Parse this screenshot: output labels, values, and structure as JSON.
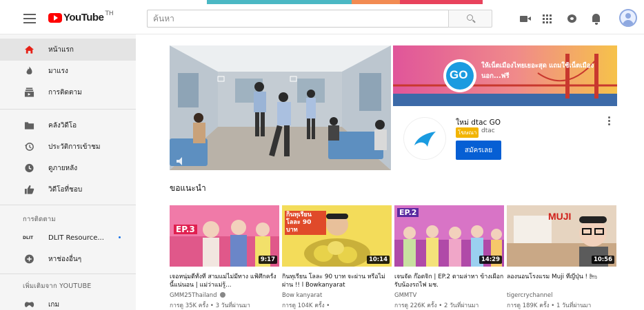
{
  "colors": {
    "brand_red": "#ff0000",
    "accent_blue": "#065fd4",
    "sidebar_bg": "#f5f5f5"
  },
  "header": {
    "logo_text": "YouTube",
    "region": "TH",
    "search_placeholder": "ค้นหา",
    "icons": [
      "menu-icon",
      "search-icon",
      "video-camera-icon",
      "apps-grid-icon",
      "messages-icon",
      "notifications-bell-icon",
      "avatar-icon"
    ]
  },
  "sidebar": {
    "main": [
      {
        "label": "หน้าแรก",
        "icon": "home-icon",
        "active": true
      },
      {
        "label": "มาแรง",
        "icon": "trending-flame-icon"
      },
      {
        "label": "การติดตาม",
        "icon": "subscriptions-icon"
      }
    ],
    "library": [
      {
        "label": "คลังวิดีโอ",
        "icon": "folder-icon"
      },
      {
        "label": "ประวัติการเข้าชม",
        "icon": "history-icon"
      },
      {
        "label": "ดูภายหลัง",
        "icon": "clock-icon"
      },
      {
        "label": "วิดีโอที่ชอบ",
        "icon": "thumbs-up-icon"
      }
    ],
    "subscriptions_heading": "การติดตาม",
    "subscriptions": [
      {
        "label": "DLIT Resource...",
        "badge": "DLIT",
        "new": true
      },
      {
        "label": "หาช่องอื่นๆ",
        "icon": "add-circle-icon"
      }
    ],
    "more_heading": "เพิ่มเติมจาก YOUTUBE",
    "more": [
      {
        "label": "เกม",
        "icon": "gaming-icon"
      }
    ]
  },
  "ad": {
    "banner_text": "ให้เน็ตเมืองไทยเยอะสุด แถมใช้เน็ตเมืองนอก...ฟรี",
    "banner_logo": "GO",
    "title": "ใหม่ dtac GO",
    "badge": "โฆษณา",
    "sponsor": "dtac",
    "cta": "สมัครเลย"
  },
  "section_title": "ขอแนะนำ",
  "videos": [
    {
      "title": "เจอหนุ่มตี๋ทั้งที่ สามแม่ไม่มีทาง แฟ้ศึกครั้งนี้แน่นอน | แม่ว่าแม่รู้...",
      "channel": "GMM25Thailand",
      "verified": true,
      "meta": "การดู 35K ครั้ง • 3 วันที่ผ่านมา",
      "duration": "9:17",
      "overlay": "EP.3"
    },
    {
      "title": "กินทุเรียน โลละ 90 บาท จะผ่าน หรือไม่ผ่าน !! l Bowkanyarat",
      "channel": "Bow kanyarat",
      "verified": false,
      "meta": "การดู 104K ครั้ง •",
      "duration": "10:14",
      "overlay": "กินทุเรียน โลละ 90 บาท"
    },
    {
      "title": "เจนจัด ก๊อตจิก | EP.2 ตามล่าหา ข้างเผือก รับน้องรถไฟ มช.",
      "channel": "GMMTV",
      "verified": false,
      "meta": "การดู 226K ครั้ง • 2 วันที่ผ่านมา",
      "duration": "14:29",
      "overlay": "EP.2"
    },
    {
      "title": "ลองนอนโรงแรม Muji ที่ญี่ปุ่น ! 🛏",
      "channel": "tigercrychannel",
      "verified": false,
      "meta": "การดู 189K ครั้ง • 1 วันที่ผ่านมา",
      "duration": "10:56",
      "overlay": "MUJI"
    }
  ]
}
